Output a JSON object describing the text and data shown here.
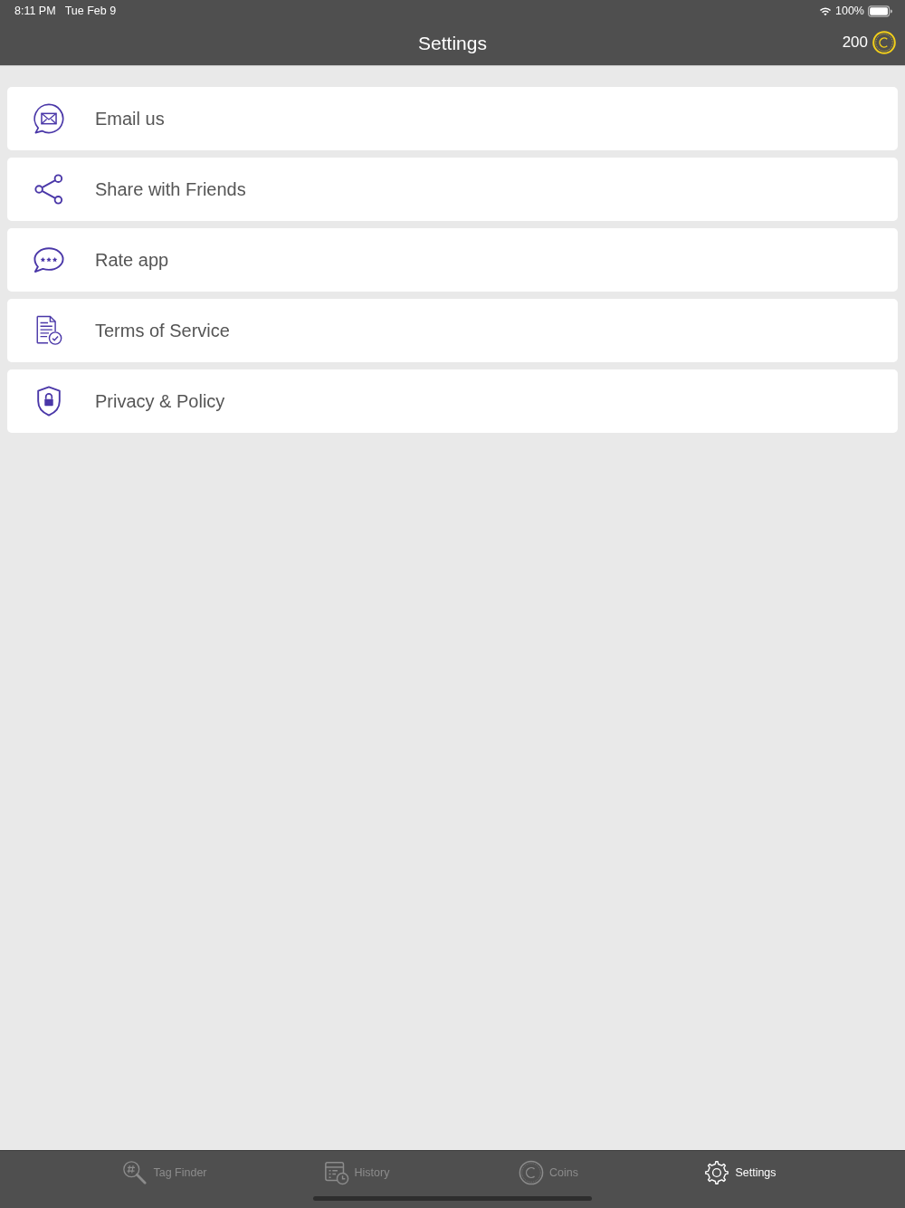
{
  "status_bar": {
    "time": "8:11 PM",
    "date": "Tue Feb 9",
    "battery_text": "100%"
  },
  "nav_bar": {
    "title": "Settings",
    "coins": "200"
  },
  "menu": [
    {
      "label": "Email us",
      "kind": "email"
    },
    {
      "label": "Share with Friends",
      "kind": "share"
    },
    {
      "label": "Rate app",
      "kind": "rate"
    },
    {
      "label": "Terms of Service",
      "kind": "terms"
    },
    {
      "label": "Privacy & Policy",
      "kind": "privacy"
    }
  ],
  "tab_bar": [
    {
      "label": "Tag Finder",
      "kind": "tag-finder",
      "selected": false
    },
    {
      "label": "History",
      "kind": "history",
      "selected": false
    },
    {
      "label": "Coins",
      "kind": "coins",
      "selected": false
    },
    {
      "label": "Settings",
      "kind": "settings",
      "selected": true
    }
  ]
}
